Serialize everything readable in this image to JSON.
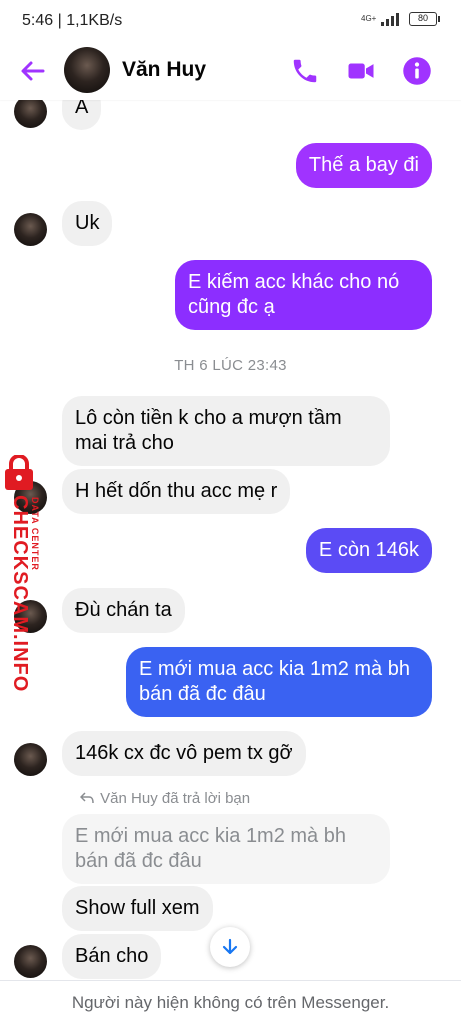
{
  "status_bar": {
    "time": "5:46 | 1,1KB/s",
    "network": "4G+",
    "battery": "80"
  },
  "header": {
    "contact_name": "Văn Huy",
    "accent_color": "#a033ff"
  },
  "messages": {
    "m1": "A",
    "m2": "Thế a bay đi",
    "m3": "Uk",
    "m4": "E kiếm acc khác cho nó cũng đc ạ",
    "timestamp": "TH 6 LÚC 23:43",
    "m5": "Lô còn tiền k cho a mượn tầm mai trả cho",
    "m6": "H hết dốn thu acc mẹ r",
    "m7": "E còn 146k",
    "m8": "Đù chán ta",
    "m9": "E mới mua acc kia 1m2 mà bh bán đã đc đâu",
    "m10": "146k cx đc vô pem tx gỡ",
    "reply_note": "Văn Huy đã trả lời bạn",
    "quoted": "E mới mua acc kia 1m2 mà bh bán đã đc đâu",
    "m11": "Show full xem",
    "m12": "Bán cho"
  },
  "watermark": {
    "brand": "CHECKSCAM.INFO",
    "sub": "DATA CENTER"
  },
  "footer": {
    "notice": "Người này hiện không có trên Messenger."
  }
}
